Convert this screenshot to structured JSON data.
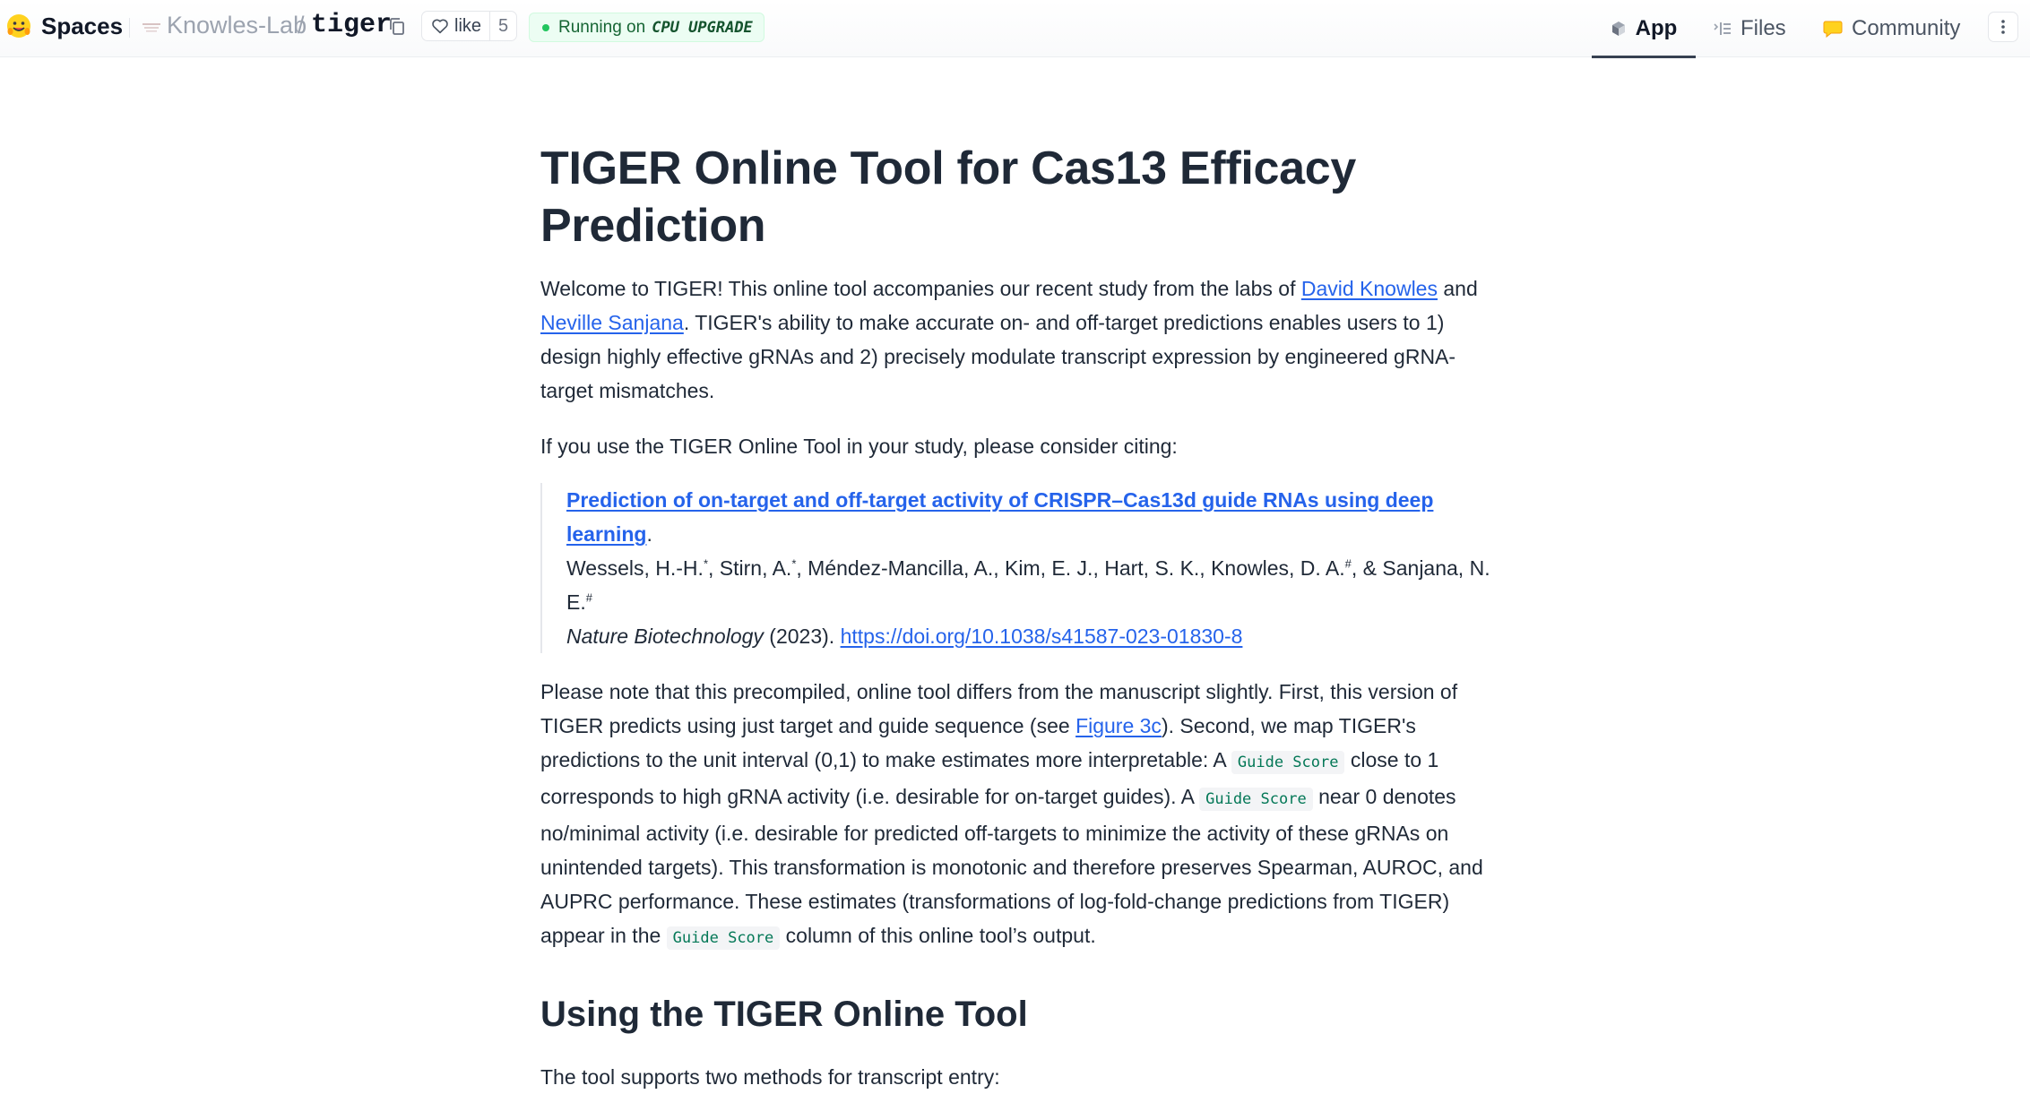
{
  "header": {
    "spaces_label": "Spaces",
    "org_name": "Knowles-Lab",
    "separator": "/",
    "repo_name": "tiger",
    "like_label": "like",
    "like_count": "5",
    "status_prefix": "Running on",
    "status_hardware": "CPU UPGRADE",
    "tabs": [
      {
        "label": "App",
        "icon": "cube-icon",
        "active": true
      },
      {
        "label": "Files",
        "icon": "files-icon",
        "active": false
      },
      {
        "label": "Community",
        "icon": "community-icon",
        "active": false
      }
    ]
  },
  "article": {
    "title": "TIGER Online Tool for Cas13 Efficacy Prediction",
    "intro": {
      "t1": "Welcome to TIGER! This online tool accompanies our recent study from the labs of ",
      "link1": "David Knowles",
      "t2": " and ",
      "link2": "Neville Sanjana",
      "t3": ". TIGER's ability to make accurate on- and off-target predictions enables users to 1) design highly effective gRNAs and 2) precisely modulate transcript expression by engineered gRNA-target mismatches."
    },
    "cite_prompt": "If you use the TIGER Online Tool in your study, please consider citing:",
    "citation": {
      "title": "Prediction of on-target and off-target activity of CRISPR–Cas13d guide RNAs using deep learning",
      "title_end": ".",
      "author1": "Wessels, H.-H.",
      "sup1": "*",
      "author2": ", Stirn, A.",
      "sup2": "*",
      "author3": ", Méndez-Mancilla, A., Kim, E. J., Hart, S. K., Knowles, D. A.",
      "sup3": "#",
      "author4": ", & Sanjana, N. E.",
      "sup4": "#",
      "journal": "Nature Biotechnology",
      "year": " (2023). ",
      "doi": "https://doi.org/10.1038/s41587-023-01830-8"
    },
    "note": {
      "t1": "Please note that this precompiled, online tool differs from the manuscript slightly. First, this version of TIGER predicts using just target and guide sequence (see ",
      "link": "Figure 3c",
      "t2": "). Second, we map TIGER's predictions to the unit interval (0,1) to make estimates more interpretable: A ",
      "code1": "Guide Score",
      "t3": " close to 1 corresponds to high gRNA activity (i.e. desirable for on-target guides). A ",
      "code2": "Guide Score",
      "t4": " near 0 denotes no/minimal activity (i.e. desirable for predicted off-targets to minimize the activity of these gRNAs on unintended targets). This transformation is monotonic and therefore preserves Spearman, AUROC, and AUPRC performance. These estimates (transformations of log-fold-change predictions from TIGER) appear in the ",
      "code3": "Guide Score",
      "t5": " column of this online tool’s output."
    },
    "section_heading": "Using the TIGER Online Tool",
    "section_text": "The tool supports two methods for transcript entry:"
  },
  "colors": {
    "link": "#2563eb",
    "code_text": "#047857",
    "status_green": "#22c55e"
  }
}
